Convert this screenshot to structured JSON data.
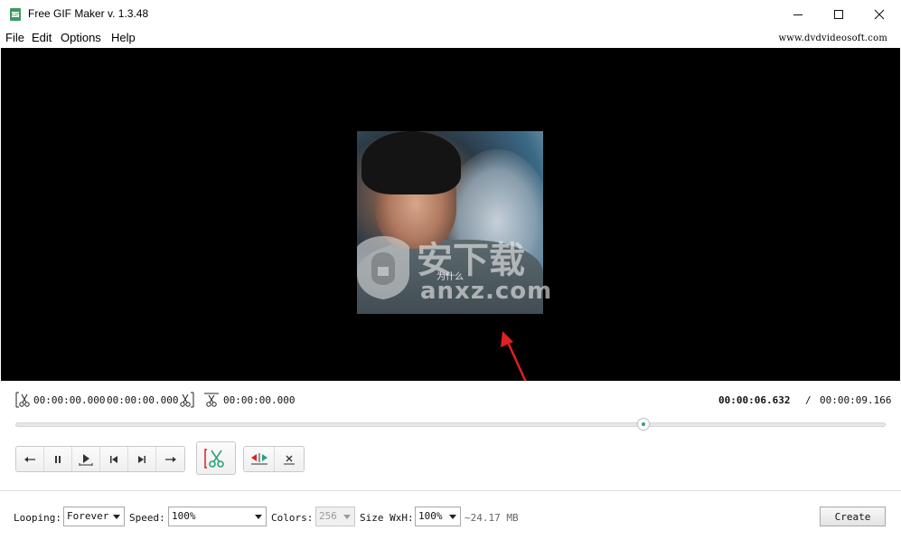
{
  "window": {
    "title": "Free GIF Maker v. 1.3.48",
    "icons": [
      "app-icon",
      "minimize-icon",
      "maximize-icon",
      "close-icon"
    ]
  },
  "menu": {
    "items": [
      "File",
      "Edit",
      "Options",
      "Help"
    ],
    "site_link": "www.dvdvideosoft.com"
  },
  "video": {
    "subtitle": "为什么",
    "watermark_cn": "安下载",
    "watermark_en": "anxz.com"
  },
  "timeline": {
    "cut_start": "00:00:00.000",
    "cut_end": "00:00:00.000",
    "cut_duration": "00:00:00.000",
    "current_time": "00:00:06.632",
    "separator": "/",
    "total_time": "00:00:09.166",
    "progress": 0.722
  },
  "playback": {
    "buttons": [
      "step-back-icon",
      "pause-icon",
      "play-selection-icon",
      "go-start-icon",
      "go-end-icon",
      "step-forward-icon"
    ],
    "cut_button": "cut-scissors-icon",
    "extra_buttons": [
      "set-marker-icon",
      "clear-marker-icon"
    ]
  },
  "settings": {
    "looping_label": "Looping:",
    "looping_value": "Forever",
    "speed_label": "Speed:",
    "speed_value": "100%",
    "colors_label": "Colors:",
    "colors_value": "256",
    "size_label": "Size WxH:",
    "size_value": "100%",
    "size_estimate": "~24.17 MB",
    "create_label": "Create"
  },
  "colors": {
    "accent_green": "#27a37c",
    "arrow_red": "#e02020"
  }
}
